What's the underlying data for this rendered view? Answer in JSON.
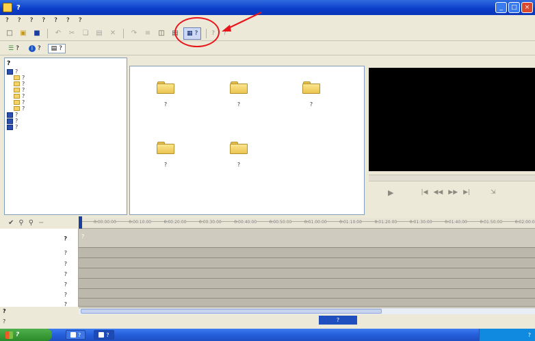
{
  "window": {
    "title": "?",
    "min_glyph": "_",
    "max_glyph": "□",
    "close_glyph": "×"
  },
  "menu": {
    "items": [
      "?",
      "?",
      "?",
      "?",
      "?",
      "?",
      "?"
    ]
  },
  "toolbar": {
    "buttons": [
      "new-document",
      "open-folder",
      "save",
      "undo",
      "cut",
      "copy",
      "paste",
      "delete",
      "redo-disabled",
      "properties",
      "collection",
      "monitor",
      "show-storyboard"
    ],
    "highlighted_label": "?",
    "after_items": [
      "?",
      "?"
    ]
  },
  "tabs": {
    "items": [
      "?",
      "?",
      "?"
    ]
  },
  "collections": {
    "header": "?",
    "root": "?",
    "children": [
      "?",
      "?",
      "?",
      "?",
      "?",
      "?"
    ],
    "extra": [
      "?",
      "?",
      "?"
    ]
  },
  "content": {
    "folders": [
      "?",
      "?",
      "?",
      "?",
      "?"
    ]
  },
  "monitor": {
    "controls": [
      "▶",
      "|◀",
      "◀◀",
      "▶▶",
      "▶|",
      "⇲"
    ]
  },
  "timeline": {
    "ruler_labels": [
      "0:00:00:00",
      "0:00:10:00",
      "0:00:20:00",
      "0:00:30:00",
      "0:00:40:00",
      "0:00:50:00",
      "0:01:00:00",
      "0:01:10:00",
      "0:01:20:00",
      "0:01:30:00",
      "0:01:40:00",
      "0:01:50:00",
      "0:02:00:00"
    ],
    "tracks": [
      "?",
      "?",
      "?",
      "?",
      "?",
      "?",
      "?"
    ],
    "video_hint": "?",
    "storyboard_toggle": "?",
    "marker_text": "?"
  },
  "status": {
    "text": "?"
  },
  "taskbar": {
    "start": "?",
    "buttons": [
      "?",
      "?"
    ],
    "tray_time": "?"
  },
  "colors": {
    "annotation": "#e8161b",
    "title_bar": "#0a3cc8",
    "taskbar": "#245edb",
    "monitor_screen": "#000000"
  }
}
